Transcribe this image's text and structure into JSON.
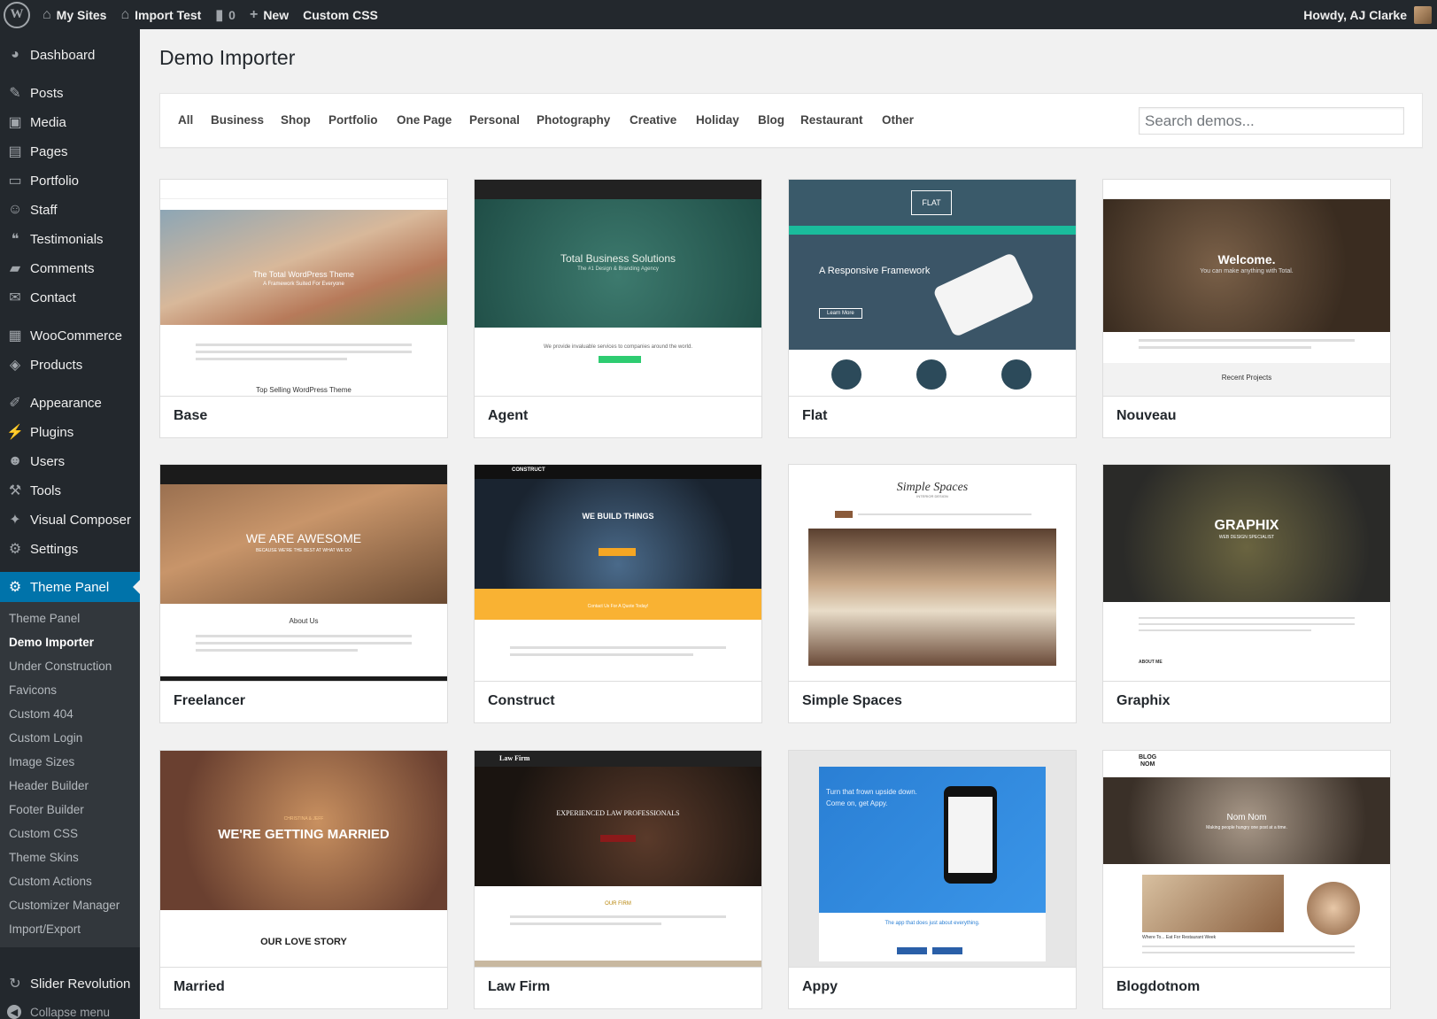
{
  "adminbar": {
    "my_sites": "My Sites",
    "site_name": "Import Test",
    "comments_count": "0",
    "new": "New",
    "custom_css": "Custom CSS",
    "howdy": "Howdy, AJ Clarke"
  },
  "sidebar": {
    "items": [
      {
        "label": "Dashboard",
        "icon": "dashboard-icon"
      },
      {
        "label": "Posts",
        "icon": "pin-icon"
      },
      {
        "label": "Media",
        "icon": "media-icon"
      },
      {
        "label": "Pages",
        "icon": "pages-icon"
      },
      {
        "label": "Portfolio",
        "icon": "portfolio-icon"
      },
      {
        "label": "Staff",
        "icon": "staff-icon"
      },
      {
        "label": "Testimonials",
        "icon": "testimonials-icon"
      },
      {
        "label": "Comments",
        "icon": "comments-icon"
      },
      {
        "label": "Contact",
        "icon": "mail-icon"
      },
      {
        "label": "WooCommerce",
        "icon": "woocommerce-icon"
      },
      {
        "label": "Products",
        "icon": "products-icon"
      },
      {
        "label": "Appearance",
        "icon": "appearance-icon"
      },
      {
        "label": "Plugins",
        "icon": "plugins-icon"
      },
      {
        "label": "Users",
        "icon": "users-icon"
      },
      {
        "label": "Tools",
        "icon": "tools-icon"
      },
      {
        "label": "Visual Composer",
        "icon": "visual-composer-icon"
      },
      {
        "label": "Settings",
        "icon": "settings-icon"
      },
      {
        "label": "Theme Panel",
        "icon": "gear-icon"
      },
      {
        "label": "Slider Revolution",
        "icon": "refresh-icon"
      }
    ],
    "submenu": [
      "Theme Panel",
      "Demo Importer",
      "Under Construction",
      "Favicons",
      "Custom 404",
      "Custom Login",
      "Image Sizes",
      "Header Builder",
      "Footer Builder",
      "Custom CSS",
      "Theme Skins",
      "Custom Actions",
      "Customizer Manager",
      "Import/Export"
    ],
    "collapse": "Collapse menu"
  },
  "page": {
    "title": "Demo Importer",
    "filters": [
      "All",
      "Business",
      "Shop",
      "Portfolio",
      "One Page",
      "Personal",
      "Photography",
      "Creative",
      "Holiday",
      "Blog",
      "Restaurant",
      "Other"
    ],
    "search_placeholder": "Search demos..."
  },
  "demos": [
    {
      "name": "Base",
      "headline": "The Total WordPress Theme",
      "sub": "A Framework Suited For Everyone",
      "caption": "Top Selling WordPress Theme"
    },
    {
      "name": "Agent",
      "headline": "Total Business Solutions",
      "sub": "The #1 Design & Branding Agency",
      "caption": "We provide invaluable services to companies around the world."
    },
    {
      "name": "Flat",
      "headline": "A Responsive Framework",
      "sub": "FLAT",
      "caption": "Learn More"
    },
    {
      "name": "Nouveau",
      "headline": "Welcome.",
      "sub": "You can make anything with Total.",
      "caption": "Recent Projects"
    },
    {
      "name": "Freelancer",
      "headline": "WE ARE AWESOME",
      "sub": "BECAUSE WE'RE THE BEST AT WHAT WE DO",
      "caption": "About Us"
    },
    {
      "name": "Construct",
      "headline": "WE BUILD THINGS",
      "sub": "CONSTRUCT",
      "caption": "Contact Us For A Quote Today!"
    },
    {
      "name": "Simple Spaces",
      "headline": "Simple Spaces",
      "sub": "INTERIOR DESIGN",
      "caption": ""
    },
    {
      "name": "Graphix",
      "headline": "GRAPHIX",
      "sub": "WEB DESIGN SPECIALIST",
      "caption": "ABOUT ME"
    },
    {
      "name": "Married",
      "headline": "WE'RE GETTING MARRIED",
      "sub": "CHRISTINA & JEFF",
      "caption": "OUR LOVE STORY"
    },
    {
      "name": "Law Firm",
      "headline": "EXPERIENCED LAW PROFESSIONALS",
      "sub": "Law Firm",
      "caption": "OUR FIRM"
    },
    {
      "name": "Appy",
      "headline": "Turn that frown upside down.",
      "sub": "Come on, get Appy.",
      "caption": "The app that does just about everything."
    },
    {
      "name": "Blogdotnom",
      "headline": "Nom Nom",
      "sub": "Making people hungry one post at a time.",
      "caption": "Where To... Eat For Restaurant Week"
    }
  ]
}
